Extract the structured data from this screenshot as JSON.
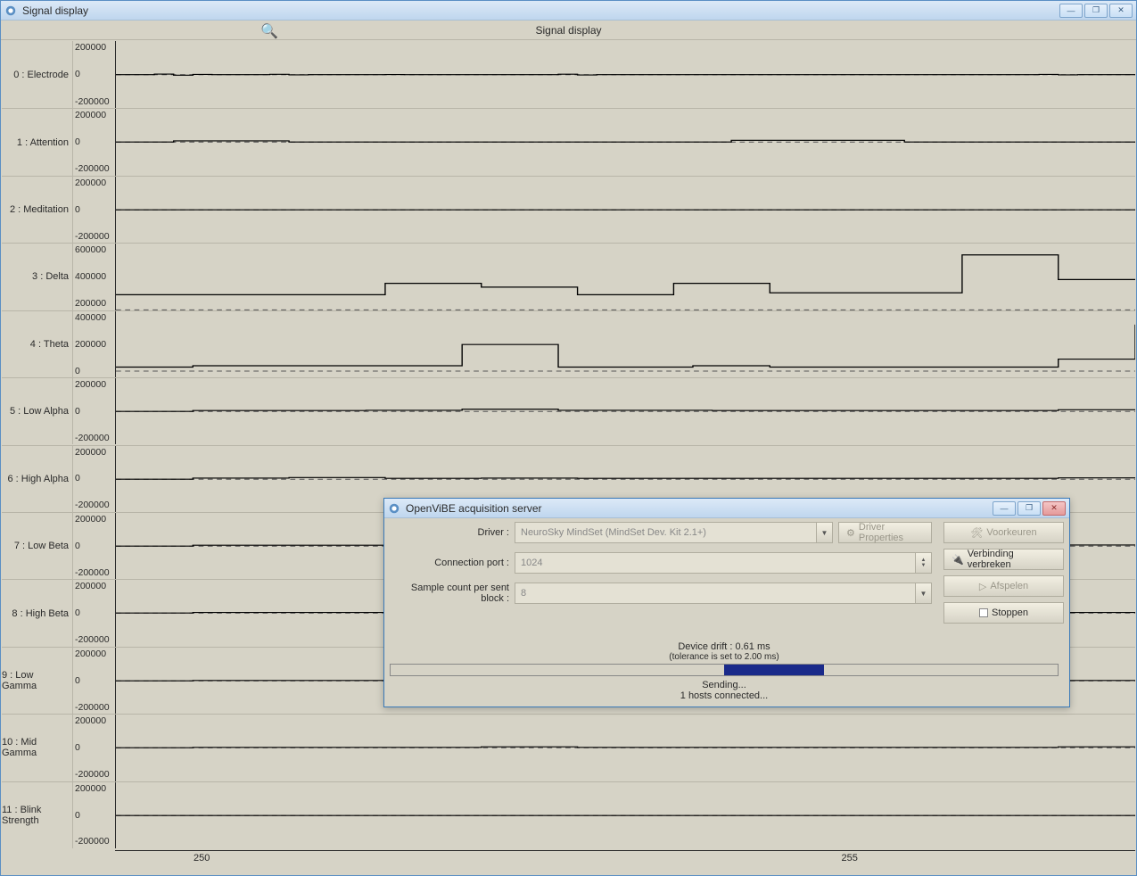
{
  "main": {
    "title": "Signal display",
    "caption": "Signal display"
  },
  "x_axis": {
    "ticks": [
      "250",
      "255"
    ]
  },
  "channels": [
    {
      "label": "0 : Electrode",
      "yticks": [
        "200000",
        "0",
        "-200000"
      ],
      "ymin": -300000,
      "ymax": 300000,
      "data": [
        0,
        0,
        5000,
        -5000,
        2000,
        0,
        0,
        0,
        3000,
        -2000,
        0,
        0,
        0,
        0,
        1000,
        0,
        0,
        0,
        0,
        0,
        0,
        0,
        0,
        4000,
        -3000,
        0,
        0,
        0,
        0,
        0,
        0,
        0,
        0,
        0,
        0,
        0,
        0,
        0,
        0,
        0,
        0,
        0,
        0,
        0,
        0,
        0,
        0,
        0,
        2000,
        -2000,
        0,
        0,
        0,
        0
      ]
    },
    {
      "label": "1 : Attention",
      "yticks": [
        "200000",
        "0",
        "-200000"
      ],
      "ymin": -300000,
      "ymax": 300000,
      "data": [
        0,
        0,
        0,
        10000,
        10000,
        10000,
        10000,
        10000,
        10000,
        0,
        0,
        0,
        0,
        0,
        0,
        0,
        0,
        0,
        0,
        0,
        0,
        0,
        0,
        0,
        0,
        0,
        0,
        0,
        0,
        0,
        0,
        0,
        15000,
        15000,
        15000,
        15000,
        15000,
        15000,
        15000,
        15000,
        15000,
        0,
        0,
        0,
        0,
        0,
        0,
        0,
        0,
        0,
        0,
        0,
        0,
        0
      ]
    },
    {
      "label": "2 : Meditation",
      "yticks": [
        "200000",
        "0",
        "-200000"
      ],
      "ymin": -300000,
      "ymax": 300000,
      "data": [
        0,
        0,
        0,
        0,
        0,
        0,
        0,
        0,
        0,
        0,
        0,
        0,
        0,
        0,
        0,
        0,
        0,
        0,
        0,
        0,
        0,
        0,
        0,
        0,
        0,
        0,
        0,
        0,
        0,
        0,
        0,
        0,
        0,
        0,
        0,
        0,
        0,
        0,
        0,
        0,
        0,
        0,
        0,
        0,
        0,
        0,
        0,
        0,
        0,
        0,
        0,
        0,
        0,
        0
      ]
    },
    {
      "label": "3 : Delta",
      "yticks": [
        "600000",
        "400000",
        "200000"
      ],
      "ymin": 0,
      "ymax": 700000,
      "data": [
        160000,
        160000,
        160000,
        160000,
        160000,
        160000,
        160000,
        160000,
        160000,
        160000,
        160000,
        160000,
        160000,
        160000,
        280000,
        280000,
        280000,
        280000,
        280000,
        240000,
        240000,
        240000,
        240000,
        240000,
        160000,
        160000,
        160000,
        160000,
        160000,
        280000,
        280000,
        280000,
        280000,
        280000,
        180000,
        180000,
        180000,
        180000,
        180000,
        180000,
        180000,
        180000,
        180000,
        180000,
        580000,
        580000,
        580000,
        580000,
        580000,
        320000,
        320000,
        320000,
        320000,
        320000
      ]
    },
    {
      "label": "4 : Theta",
      "yticks": [
        "400000",
        "200000",
        "0"
      ],
      "ymin": -50000,
      "ymax": 450000,
      "data": [
        30000,
        30000,
        30000,
        30000,
        40000,
        40000,
        40000,
        40000,
        40000,
        40000,
        40000,
        40000,
        40000,
        40000,
        40000,
        40000,
        40000,
        40000,
        200000,
        200000,
        200000,
        200000,
        200000,
        30000,
        30000,
        30000,
        30000,
        30000,
        30000,
        30000,
        40000,
        40000,
        40000,
        40000,
        30000,
        30000,
        30000,
        30000,
        30000,
        30000,
        30000,
        30000,
        30000,
        30000,
        30000,
        30000,
        30000,
        30000,
        30000,
        90000,
        90000,
        90000,
        90000,
        350000
      ]
    },
    {
      "label": "5 : Low Alpha",
      "yticks": [
        "200000",
        "0",
        "-200000"
      ],
      "ymin": -300000,
      "ymax": 300000,
      "data": [
        0,
        0,
        0,
        0,
        8000,
        8000,
        8000,
        8000,
        8000,
        8000,
        8000,
        8000,
        8000,
        10000,
        10000,
        10000,
        10000,
        10000,
        20000,
        20000,
        20000,
        20000,
        20000,
        10000,
        10000,
        10000,
        10000,
        10000,
        10000,
        10000,
        10000,
        8000,
        8000,
        8000,
        8000,
        8000,
        8000,
        8000,
        8000,
        8000,
        8000,
        8000,
        8000,
        8000,
        8000,
        8000,
        8000,
        8000,
        8000,
        15000,
        15000,
        15000,
        15000,
        15000
      ]
    },
    {
      "label": "6 : High Alpha",
      "yticks": [
        "200000",
        "0",
        "-200000"
      ],
      "ymin": -300000,
      "ymax": 300000,
      "data": [
        0,
        0,
        0,
        0,
        10000,
        10000,
        10000,
        10000,
        10000,
        15000,
        15000,
        15000,
        15000,
        15000,
        8000,
        8000,
        8000,
        8000,
        8000,
        10000,
        10000,
        10000,
        10000,
        10000,
        8000,
        8000,
        8000,
        8000,
        8000,
        8000,
        8000,
        8000,
        8000,
        8000,
        8000,
        8000,
        8000,
        8000,
        8000,
        8000,
        8000,
        8000,
        8000,
        8000,
        8000,
        8000,
        8000,
        8000,
        8000,
        12000,
        12000,
        12000,
        12000,
        12000
      ]
    },
    {
      "label": "7 : Low Beta",
      "yticks": [
        "200000",
        "0",
        "-200000"
      ],
      "ymin": -300000,
      "ymax": 300000,
      "data": [
        0,
        0,
        0,
        0,
        8000,
        8000,
        8000,
        8000,
        8000,
        8000,
        8000,
        8000,
        8000,
        8000,
        8000,
        8000,
        8000,
        8000,
        15000,
        15000,
        15000,
        15000,
        15000,
        8000,
        8000,
        8000,
        8000,
        8000,
        8000,
        8000,
        8000,
        8000,
        8000,
        8000,
        8000,
        8000,
        8000,
        8000,
        8000,
        8000,
        8000,
        8000,
        8000,
        8000,
        8000,
        8000,
        8000,
        8000,
        8000,
        10000,
        10000,
        10000,
        10000,
        10000
      ]
    },
    {
      "label": "8 : High Beta",
      "yticks": [
        "200000",
        "0",
        "-200000"
      ],
      "ymin": -300000,
      "ymax": 300000,
      "data": [
        0,
        0,
        0,
        0,
        5000,
        5000,
        5000,
        5000,
        5000,
        5000,
        5000,
        5000,
        5000,
        5000,
        5000,
        5000,
        5000,
        5000,
        5000,
        5000,
        5000,
        5000,
        5000,
        5000,
        5000,
        5000,
        5000,
        5000,
        5000,
        5000,
        5000,
        5000,
        5000,
        5000,
        5000,
        5000,
        5000,
        5000,
        5000,
        5000,
        5000,
        5000,
        5000,
        5000,
        5000,
        5000,
        5000,
        5000,
        5000,
        5000,
        5000,
        5000,
        5000,
        5000
      ]
    },
    {
      "label": "9 : Low Gamma",
      "yticks": [
        "200000",
        "0",
        "-200000"
      ],
      "ymin": -300000,
      "ymax": 300000,
      "data": [
        0,
        0,
        0,
        0,
        3000,
        3000,
        3000,
        3000,
        3000,
        3000,
        3000,
        3000,
        3000,
        3000,
        3000,
        3000,
        3000,
        3000,
        3000,
        3000,
        3000,
        3000,
        3000,
        3000,
        3000,
        3000,
        3000,
        3000,
        3000,
        3000,
        3000,
        3000,
        3000,
        3000,
        3000,
        3000,
        3000,
        3000,
        3000,
        3000,
        3000,
        3000,
        3000,
        3000,
        3000,
        3000,
        3000,
        3000,
        3000,
        3000,
        3000,
        3000,
        3000,
        3000
      ]
    },
    {
      "label": "10 : Mid Gamma",
      "yticks": [
        "200000",
        "0",
        "-200000"
      ],
      "ymin": -300000,
      "ymax": 300000,
      "data": [
        0,
        0,
        0,
        0,
        3000,
        3000,
        3000,
        3000,
        3000,
        3000,
        3000,
        3000,
        3000,
        3000,
        3000,
        3000,
        3000,
        3000,
        3000,
        8000,
        8000,
        8000,
        8000,
        8000,
        3000,
        3000,
        3000,
        3000,
        3000,
        3000,
        3000,
        3000,
        3000,
        3000,
        3000,
        3000,
        3000,
        3000,
        3000,
        3000,
        3000,
        3000,
        3000,
        3000,
        3000,
        3000,
        3000,
        3000,
        3000,
        8000,
        8000,
        8000,
        8000,
        8000
      ]
    },
    {
      "label": "11 : Blink Strength",
      "yticks": [
        "200000",
        "0",
        "-200000"
      ],
      "ymin": -300000,
      "ymax": 300000,
      "data": [
        0,
        0,
        0,
        0,
        0,
        0,
        0,
        0,
        0,
        0,
        0,
        0,
        0,
        0,
        0,
        0,
        0,
        0,
        0,
        0,
        0,
        0,
        0,
        0,
        0,
        0,
        0,
        0,
        0,
        0,
        0,
        0,
        0,
        0,
        0,
        0,
        0,
        0,
        0,
        0,
        0,
        0,
        0,
        0,
        0,
        0,
        0,
        0,
        0,
        0,
        0,
        0,
        0,
        0
      ]
    }
  ],
  "dialog": {
    "title": "OpenViBE acquisition server",
    "labels": {
      "driver": "Driver :",
      "port": "Connection port :",
      "block": "Sample count per sent block :"
    },
    "driver_value": "NeuroSky MindSet (MindSet Dev. Kit 2.1+)",
    "port_value": "1024",
    "block_value": "8",
    "driver_properties": "Driver Properties",
    "buttons": {
      "prefs": "Voorkeuren",
      "disconnect": "Verbinding verbreken",
      "play": "Afspelen",
      "stop": "Stoppen"
    },
    "status": {
      "drift": "Device drift : 0.61 ms",
      "tolerance": "(tolerance is set to 2.00 ms)",
      "sending": "Sending...",
      "hosts": "1 hosts connected..."
    }
  }
}
